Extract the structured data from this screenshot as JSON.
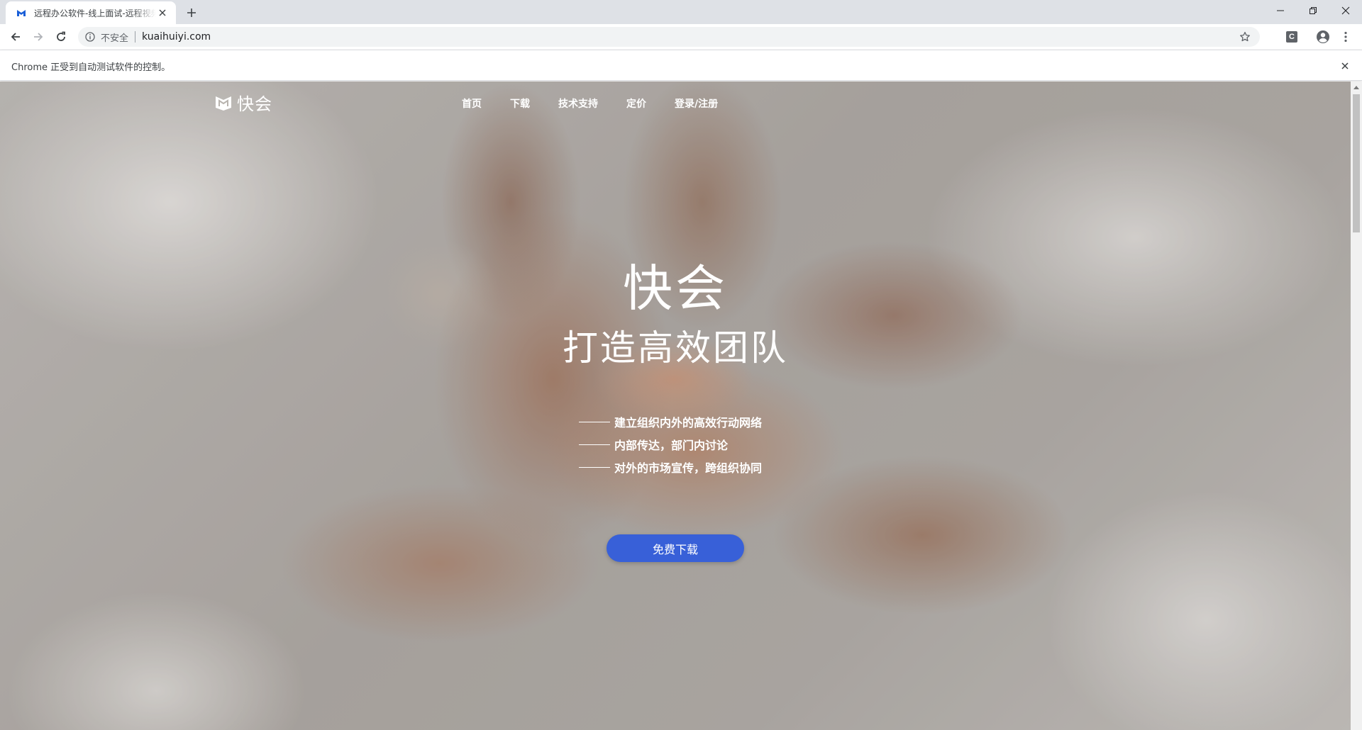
{
  "browser": {
    "tab": {
      "title": "远程办公软件-线上面试-远程视频会议",
      "favicon": "kuaihui-favicon-icon"
    },
    "address": {
      "security_label": "不安全",
      "url": "kuaihuiyi.com"
    },
    "infobar": {
      "text": "Chrome 正受到自动测试软件的控制。"
    },
    "extension_label": "C"
  },
  "site": {
    "logo_text": "快会",
    "nav": [
      {
        "label": "首页"
      },
      {
        "label": "下载"
      },
      {
        "label": "技术支持"
      },
      {
        "label": "定价"
      },
      {
        "label": "登录/注册"
      }
    ],
    "hero": {
      "title": "快会",
      "subtitle": "打造高效团队",
      "features": [
        "建立组织内外的高效行动网络",
        "内部传达，部门内讨论",
        "对外的市场宣传，跨组织协同"
      ],
      "cta_label": "免费下载"
    }
  },
  "colors": {
    "cta_background": "#3860d8",
    "tabstrip_background": "#dee1e6",
    "omnibox_background": "#f1f3f4"
  }
}
